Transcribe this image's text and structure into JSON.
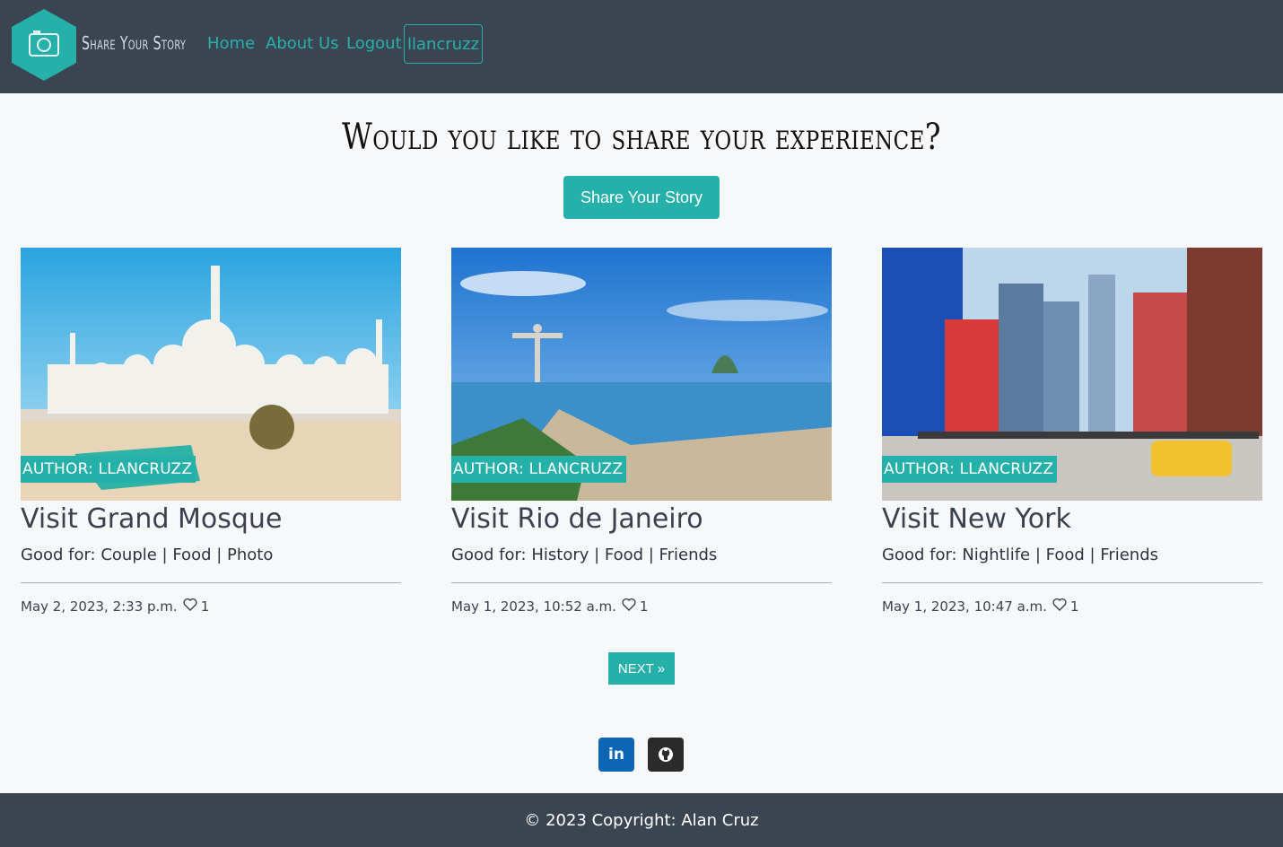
{
  "colors": {
    "accent": "#25b1aa",
    "navbar": "#3b4552",
    "linkedin": "#0d66b3",
    "github": "#2b2b2b"
  },
  "navbar": {
    "brand": "Share Your Story",
    "links": [
      "Home",
      "About Us",
      "Logout"
    ],
    "user": "llancruzz"
  },
  "hero": {
    "title": "Would you like to share your experience?",
    "button": "Share Your Story"
  },
  "cards": [
    {
      "author": "Author: llancruzz",
      "title": "Visit Grand Mosque",
      "tags": "Good for: Couple | Food | Photo",
      "date": "May 2, 2023, 2:33 p.m.",
      "likes": "1",
      "image": "grand-mosque-photo"
    },
    {
      "author": "Author: llancruzz",
      "title": "Visit Rio de Janeiro",
      "tags": "Good for: History | Food | Friends",
      "date": "May 1, 2023, 10:52 a.m.",
      "likes": "1",
      "image": "rio-de-janeiro-photo"
    },
    {
      "author": "Author: llancruzz",
      "title": "Visit New York",
      "tags": "Good for: Nightlife | Food | Friends",
      "date": "May 1, 2023, 10:47 a.m.",
      "likes": "1",
      "image": "new-york-photo"
    }
  ],
  "pagination": {
    "next": "Next »"
  },
  "social": {
    "linkedin": "in",
    "github_icon": "github-icon"
  },
  "footer": {
    "copyright": "© 2023 Copyright: Alan Cruz"
  }
}
